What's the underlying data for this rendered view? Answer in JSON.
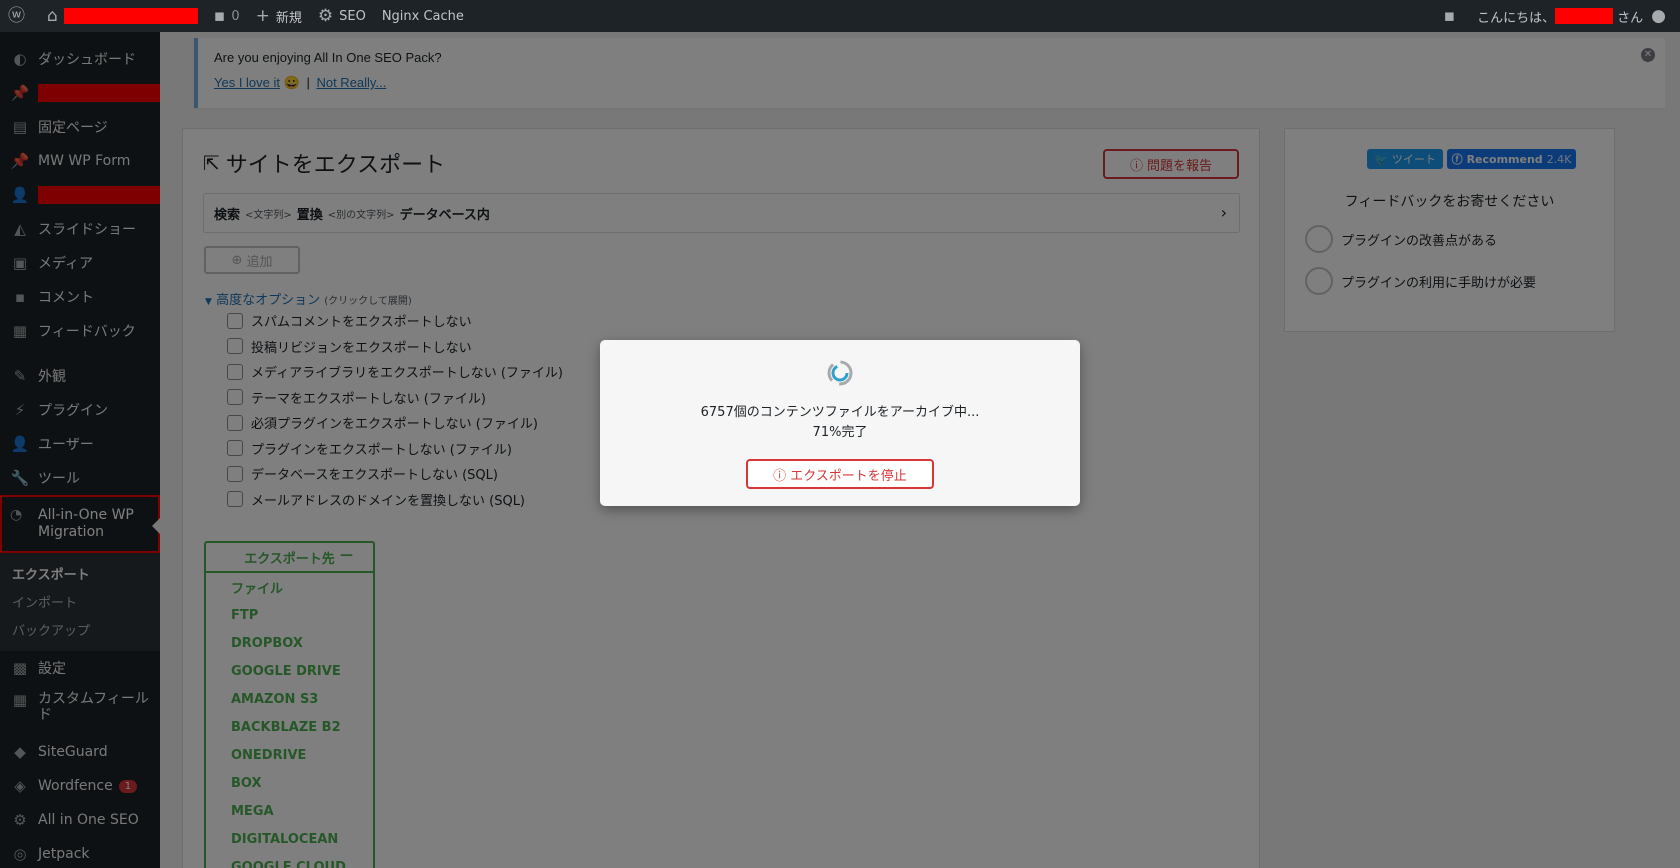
{
  "admin_bar": {
    "comment_count": "0",
    "new_label": "新規",
    "seo_label": "SEO",
    "nginx_label": "Nginx Cache",
    "greeting": "こんにちは、",
    "greeting_suffix": "さん"
  },
  "sidebar": {
    "items_top": [
      {
        "label": "ダッシュボード",
        "icon": "dashboard-icon"
      },
      {
        "label": "",
        "icon": "pin-icon",
        "redacted": true
      },
      {
        "label": "固定ページ",
        "icon": "page-icon"
      },
      {
        "label": "MW WP Form",
        "icon": "pin-icon"
      },
      {
        "label": "",
        "icon": "user-icon",
        "redacted": true
      },
      {
        "label": "スライドショー",
        "icon": "slideshow-icon"
      },
      {
        "label": "メディア",
        "icon": "media-icon"
      },
      {
        "label": "コメント",
        "icon": "comment-icon"
      },
      {
        "label": "フィードバック",
        "icon": "feedback-icon"
      }
    ],
    "items_mid": [
      {
        "label": "外観",
        "icon": "brush-icon"
      },
      {
        "label": "プラグイン",
        "icon": "plugin-icon"
      },
      {
        "label": "ユーザー",
        "icon": "user-icon"
      },
      {
        "label": "ツール",
        "icon": "wrench-icon"
      }
    ],
    "active_item": "All-in-One WP Migration",
    "submenu": [
      "エクスポート",
      "インポート",
      "バックアップ"
    ],
    "items_bottom": [
      {
        "label": "設定",
        "icon": "settings-icon"
      },
      {
        "label": "カスタムフィールド",
        "icon": "table-icon"
      },
      {
        "label": "SiteGuard",
        "icon": "siteguard-icon"
      },
      {
        "label": "Wordfence",
        "icon": "wordfence-icon",
        "badge": "1"
      },
      {
        "label": "All in One SEO",
        "icon": "gear-icon"
      },
      {
        "label": "Jetpack",
        "icon": "jetpack-icon"
      }
    ]
  },
  "notice": {
    "question": "Are you enjoying All In One SEO Pack?",
    "yes_link": "Yes I love it",
    "separator": "|",
    "no_link": "Not Really..."
  },
  "export": {
    "title": "サイトをエクスポート",
    "report_button": "問題を報告",
    "search": {
      "label1": "検索",
      "ph1": "<文字列>",
      "label2": "置換",
      "ph2": "<別の文字列>",
      "label3": "データベース内"
    },
    "add_button": "追加",
    "advanced": {
      "link": "高度なオプション",
      "hint": "(クリックして展開)"
    },
    "options": [
      "スパムコメントをエクスポートしない",
      "投稿リビジョンをエクスポートしない",
      "メディアライブラリをエクスポートしない (ファイル)",
      "テーマをエクスポートしない (ファイル)",
      "必須プラグインをエクスポートしない (ファイル)",
      "プラグインをエクスポートしない (ファイル)",
      "データベースをエクスポートしない (SQL)",
      "メールアドレスのドメインを置換しない (SQL)"
    ],
    "destination_header": "エクスポート先",
    "destinations": [
      "ファイル",
      "FTP",
      "DROPBOX",
      "GOOGLE DRIVE",
      "AMAZON S3",
      "BACKBLAZE B2",
      "ONEDRIVE",
      "BOX",
      "MEGA",
      "DIGITALOCEAN",
      "GOOGLE CLOUD"
    ]
  },
  "feedback": {
    "tweet": "ツイート",
    "recommend": "Recommend",
    "recommend_count": "2.4K",
    "title": "フィードバックをお寄せください",
    "options": [
      "プラグインの改善点がある",
      "プラグインの利用に手助けが必要"
    ]
  },
  "modal": {
    "message": "6757個のコンテンツファイルをアーカイブ中...",
    "progress_text": "71%完了",
    "progress": 0.71,
    "stop_button": "エクスポートを停止"
  },
  "colors": {
    "accent": "#2271b1",
    "danger": "#d63638",
    "success": "#4caf50",
    "admin_bg": "#1d2327"
  }
}
